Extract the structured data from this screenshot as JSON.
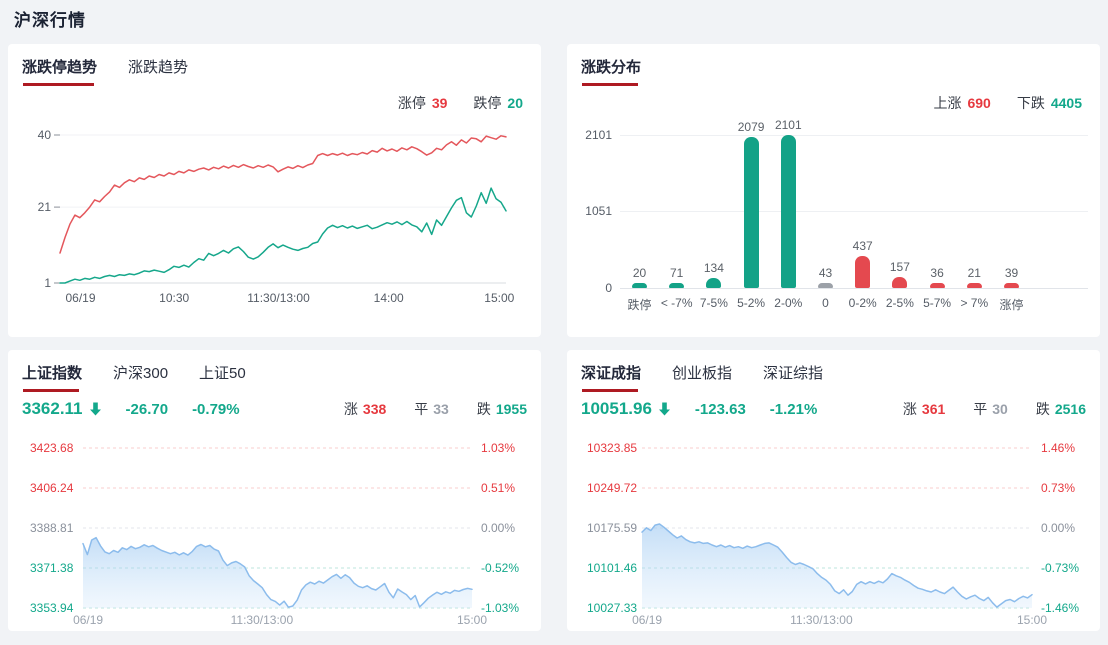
{
  "page": {
    "title": "沪深行情"
  },
  "colors": {
    "red": "#e6393f",
    "teal": "#13a88b",
    "gray": "#9aa0aa",
    "dark_label": "#363b45",
    "active_underline": "#ae1a22",
    "bar_teal": "#13a287",
    "bar_red": "#e4494f",
    "bar_gray": "#9ca1a8",
    "line_red": "#e4575c",
    "line_teal": "#16a78b",
    "area_line": "#8cbcec",
    "page_bg": "#f1f3f6",
    "panel_bg": "#ffffff"
  },
  "panels": {
    "limit_trend": {
      "tabs": [
        "涨跌停趋势",
        "涨跌趋势"
      ],
      "legend": [
        {
          "label": "涨停",
          "value": "39",
          "color": "red"
        },
        {
          "label": "跌停",
          "value": "20",
          "color": "teal"
        }
      ]
    },
    "distribution": {
      "tabs": [
        "涨跌分布"
      ],
      "legend": [
        {
          "label": "上涨",
          "value": "690",
          "color": "red"
        },
        {
          "label": "下跌",
          "value": "4405",
          "color": "teal"
        }
      ]
    },
    "sh_index": {
      "tabs": [
        "上证指数",
        "沪深300",
        "上证50"
      ],
      "stats": {
        "value": "3362.11",
        "change": "-26.70",
        "pct": "-0.79%",
        "direction": "down"
      },
      "counts": [
        {
          "label": "涨",
          "value": "338",
          "color": "red"
        },
        {
          "label": "平",
          "value": "33",
          "color": "gray"
        },
        {
          "label": "跌",
          "value": "1955",
          "color": "teal"
        }
      ]
    },
    "sz_index": {
      "tabs": [
        "深证成指",
        "创业板指",
        "深证综指"
      ],
      "stats": {
        "value": "10051.96",
        "change": "-123.63",
        "pct": "-1.21%",
        "direction": "down"
      },
      "counts": [
        {
          "label": "涨",
          "value": "361",
          "color": "red"
        },
        {
          "label": "平",
          "value": "30",
          "color": "gray"
        },
        {
          "label": "跌",
          "value": "2516",
          "color": "teal"
        }
      ]
    }
  },
  "chart_data": [
    {
      "id": "limit-trend-chart",
      "type": "line",
      "title": "涨跌停趋势",
      "ylim": [
        1,
        40
      ],
      "y_ticks": [
        {
          "value": 40,
          "label": "40"
        },
        {
          "value": 21,
          "label": "21"
        },
        {
          "value": 1,
          "label": "1",
          "axis": true
        }
      ],
      "x_labels": [
        {
          "t": "06/19",
          "p": 0.046
        },
        {
          "t": "10:30",
          "p": 0.256
        },
        {
          "t": "11:30/13:00",
          "p": 0.49
        },
        {
          "t": "14:00",
          "p": 0.737
        },
        {
          "t": "15:00",
          "p": 0.985
        }
      ],
      "series": [
        {
          "name": "涨停",
          "color": "#e4575c",
          "values": [
            8.9,
            13,
            16.5,
            18.9,
            18.2,
            19.5,
            21,
            22.9,
            22.4,
            23.8,
            25,
            26.8,
            26.2,
            27.4,
            28.2,
            27.7,
            28.7,
            28.3,
            29.2,
            28.8,
            29.6,
            29.2,
            30,
            29.6,
            30.4,
            30,
            30.8,
            30.4,
            31,
            31.3,
            30.8,
            31.5,
            31.1,
            31.8,
            31.3,
            32,
            31.5,
            32.2,
            31.7,
            31.3,
            31.9,
            31.5,
            32.1,
            31.6,
            30.3,
            31,
            31.6,
            31.2,
            31.9,
            31.4,
            32.1,
            32.5,
            34.6,
            35.1,
            34.6,
            35.1,
            34.7,
            35.2,
            34.6,
            35.1,
            34.8,
            35.4,
            35,
            35.9,
            35.5,
            36.5,
            35.8,
            36.3,
            35.7,
            36.6,
            36.1,
            36.9,
            36.4,
            35.6,
            34.7,
            35.3,
            36.5,
            36.1,
            37.4,
            38.2,
            37.3,
            38.7,
            37.9,
            39.2,
            39,
            38.2,
            39.7,
            39.3,
            38.9,
            39.8,
            39.5
          ]
        },
        {
          "name": "跌停",
          "color": "#16a78b",
          "values": [
            1,
            1,
            1.5,
            2,
            1.7,
            2.2,
            2,
            2.5,
            2.2,
            2.7,
            3,
            2.7,
            3.2,
            3,
            3.4,
            3.2,
            3.6,
            4.2,
            4,
            4.4,
            4.1,
            3.8,
            4.5,
            5.4,
            5.1,
            5.7,
            5.2,
            6.4,
            7.4,
            7,
            8.8,
            8.2,
            8.8,
            9.6,
            8.9,
            10,
            10.5,
            9.3,
            7.8,
            7.3,
            7.9,
            9.1,
            10.4,
            11.3,
            10.3,
            11,
            10.4,
            9.9,
            9.6,
            10.1,
            10.4,
            11.4,
            11.8,
            13.9,
            15.5,
            16.2,
            15.6,
            16.1,
            15.5,
            16,
            15.4,
            15.8,
            16.2,
            15.3,
            15.7,
            16.3,
            16.9,
            16.5,
            17.1,
            16.4,
            17.2,
            16.3,
            15.8,
            14.5,
            16.8,
            13.8,
            17.6,
            16.2,
            18.5,
            20.8,
            22.8,
            23.5,
            19.5,
            18.4,
            21.3,
            24.8,
            22,
            26,
            23.2,
            22.3,
            20
          ]
        }
      ]
    },
    {
      "id": "distribution-chart",
      "type": "bar",
      "title": "涨跌分布",
      "categories": [
        "跌停",
        "< -7%",
        "7-5%",
        "5-2%",
        "2-0%",
        "0",
        "0-2%",
        "2-5%",
        "5-7%",
        "> 7%",
        "涨停"
      ],
      "values": [
        20,
        71,
        134,
        2079,
        2101,
        43,
        437,
        157,
        36,
        21,
        39
      ],
      "bar_colors": [
        "teal",
        "teal",
        "teal",
        "teal",
        "teal",
        "gray",
        "red",
        "red",
        "red",
        "red",
        "red"
      ],
      "y_ticks": [
        2101,
        1051,
        0
      ],
      "ylim": [
        0,
        2101
      ]
    },
    {
      "id": "sh-index-chart",
      "type": "area",
      "grid": "dash",
      "title": "上证指数",
      "ylim": [
        3353.94,
        3423.68
      ],
      "y_ticks": [
        {
          "value": 3423.68,
          "label": "3423.68",
          "pct": "1.03%",
          "color": "red"
        },
        {
          "value": 3406.24,
          "label": "3406.24",
          "pct": "0.51%",
          "color": "red"
        },
        {
          "value": 3388.81,
          "label": "3388.81",
          "pct": "0.00%",
          "color": "gray"
        },
        {
          "value": 3371.38,
          "label": "3371.38",
          "pct": "-0.52%",
          "color": "teal"
        },
        {
          "value": 3353.94,
          "label": "3353.94",
          "pct": "-1.03%",
          "color": "teal"
        }
      ],
      "x_labels": [
        {
          "t": "06/19",
          "p": 0.013
        },
        {
          "t": "11:30/13:00",
          "p": 0.46
        },
        {
          "t": "15:00",
          "p": 1.0
        }
      ],
      "series": [
        {
          "name": "上证指数",
          "color": "#8cbcec",
          "area": true,
          "values": [
            3382,
            3377.2,
            3383.6,
            3384.6,
            3381,
            3378.4,
            3377.6,
            3379,
            3378.2,
            3380.2,
            3379.4,
            3380.8,
            3379.8,
            3380.4,
            3381.5,
            3380.6,
            3381.2,
            3380,
            3379,
            3378.3,
            3377.6,
            3378.2,
            3377.1,
            3378,
            3377,
            3378.6,
            3380.8,
            3381.6,
            3380.6,
            3381.2,
            3379.6,
            3378.8,
            3374.8,
            3372.4,
            3373.6,
            3374.2,
            3373.2,
            3371.8,
            3368,
            3365.9,
            3364.4,
            3362.8,
            3359.8,
            3357.6,
            3356.8,
            3355.2,
            3356.9,
            3354.3,
            3354.8,
            3357.4,
            3361.8,
            3364,
            3365.2,
            3364.4,
            3365.6,
            3364.8,
            3366.2,
            3367.6,
            3368.6,
            3366.9,
            3368.4,
            3367.2,
            3364.8,
            3363.4,
            3362.8,
            3363.6,
            3362.4,
            3361.8,
            3363.2,
            3364.6,
            3360.8,
            3358.4,
            3362.2,
            3360.9,
            3359.8,
            3357.6,
            3359.4,
            3354.4,
            3356.2,
            3358.2,
            3359.6,
            3360.8,
            3359.9,
            3361,
            3360.4,
            3361.6,
            3361.2,
            3362,
            3362.5,
            3362.11
          ]
        }
      ]
    },
    {
      "id": "sz-index-chart",
      "type": "area",
      "grid": "dash",
      "title": "深证成指",
      "ylim": [
        10027.33,
        10323.85
      ],
      "y_ticks": [
        {
          "value": 10323.85,
          "label": "10323.85",
          "pct": "1.46%",
          "color": "red"
        },
        {
          "value": 10249.72,
          "label": "10249.72",
          "pct": "0.73%",
          "color": "red"
        },
        {
          "value": 10175.59,
          "label": "10175.59",
          "pct": "0.00%",
          "color": "gray"
        },
        {
          "value": 10101.46,
          "label": "10101.46",
          "pct": "-0.73%",
          "color": "teal"
        },
        {
          "value": 10027.33,
          "label": "10027.33",
          "pct": "-1.46%",
          "color": "teal"
        }
      ],
      "x_labels": [
        {
          "t": "06/19",
          "p": 0.013
        },
        {
          "t": "11:30/13:00",
          "p": 0.46
        },
        {
          "t": "15:00",
          "p": 1.0
        }
      ],
      "series": [
        {
          "name": "深证成指",
          "color": "#8cbcec",
          "area": true,
          "values": [
            10168,
            10176,
            10171,
            10181,
            10183,
            10177,
            10170,
            10163,
            10157,
            10161,
            10154,
            10150,
            10148,
            10150,
            10147,
            10148,
            10144,
            10141,
            10144,
            10140,
            10143,
            10139,
            10141,
            10138,
            10142,
            10139,
            10141,
            10144,
            10147,
            10148,
            10144,
            10140,
            10131,
            10121,
            10112,
            10108,
            10111,
            10108,
            10104,
            10100,
            10091,
            10084,
            10079,
            10071,
            10059,
            10054,
            10061,
            10051,
            10058,
            10071,
            10076,
            10072,
            10076,
            10073,
            10077,
            10074,
            10081,
            10091,
            10087,
            10084,
            10079,
            10075,
            10069,
            10064,
            10062,
            10059,
            10057,
            10061,
            10057,
            10054,
            10060,
            10066,
            10057,
            10049,
            10044,
            10048,
            10051,
            10045,
            10041,
            10047,
            10037,
            10029,
            10035,
            10041,
            10043,
            10039,
            10045,
            10049,
            10046,
            10051.96
          ]
        }
      ]
    }
  ]
}
